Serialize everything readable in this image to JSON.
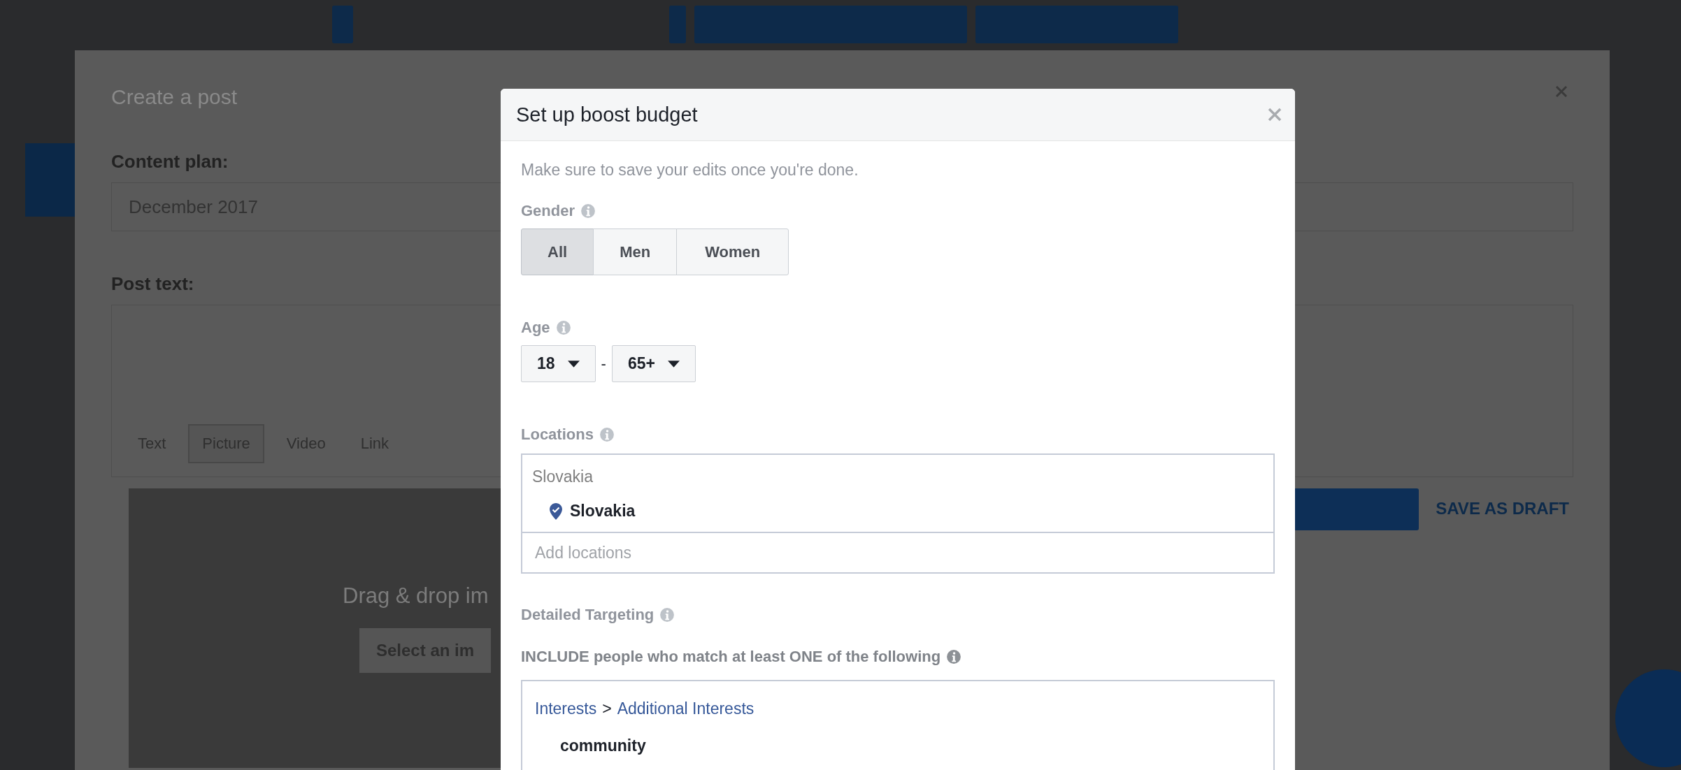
{
  "background_page": {
    "title": "Create a post",
    "content_plan_label": "Content plan:",
    "content_plan_value": "December 2017",
    "post_text_label": "Post text:",
    "post_types": [
      {
        "label": "Text",
        "selected": false
      },
      {
        "label": "Picture",
        "selected": true
      },
      {
        "label": "Video",
        "selected": false
      },
      {
        "label": "Link",
        "selected": false
      }
    ],
    "drop_text": "Drag & drop im",
    "select_button": "Select an im",
    "save_draft": "SAVE AS DRAFT"
  },
  "dialog": {
    "title": "Set up boost budget",
    "note": "Make sure to save your edits once you're done.",
    "gender": {
      "label": "Gender",
      "options": [
        {
          "label": "All",
          "selected": true
        },
        {
          "label": "Men",
          "selected": false
        },
        {
          "label": "Women",
          "selected": false
        }
      ]
    },
    "age": {
      "label": "Age",
      "from": "18",
      "separator": "-",
      "to": "65+"
    },
    "locations": {
      "label": "Locations",
      "search_value": "Slovakia",
      "selected": [
        "Slovakia"
      ],
      "placeholder": "Add locations"
    },
    "detailed_targeting": {
      "label": "Detailed Targeting",
      "include_label": "INCLUDE people who match at least ONE of the following",
      "path": [
        "Interests",
        "Additional Interests"
      ],
      "path_separator": ">",
      "items": [
        "community"
      ]
    }
  }
}
